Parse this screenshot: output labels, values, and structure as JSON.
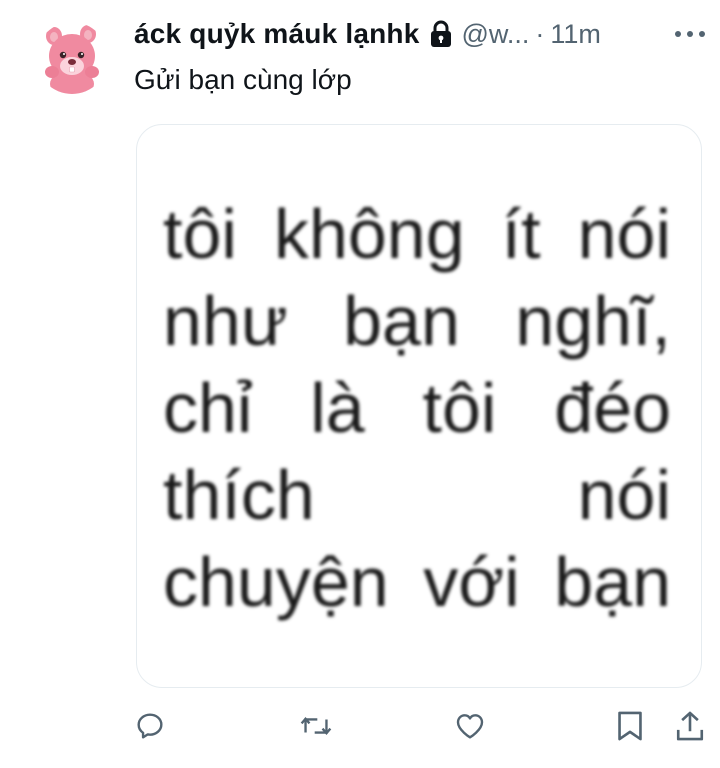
{
  "tweet": {
    "display_name": "áck quỷk máuk lạnhk",
    "handle": "@w...",
    "separator": "·",
    "time": "11m",
    "text": "Gửi bạn cùng lớp",
    "media_text_lines": [
      [
        "tôi",
        "không",
        "ít",
        "nói"
      ],
      [
        "như",
        "bạn",
        "nghĩ,"
      ],
      [
        "chỉ",
        "là",
        "tôi",
        "đéo"
      ],
      [
        "thích",
        "nói"
      ],
      [
        "chuyện",
        "với",
        "bạn"
      ]
    ]
  },
  "icons": {
    "lock": "lock-icon",
    "more": "more-icon",
    "reply": "reply-icon",
    "retweet": "retweet-icon",
    "like": "heart-icon",
    "bookmark": "bookmark-icon",
    "share": "share-icon",
    "avatar": "pink-beaver-avatar"
  },
  "colors": {
    "text_primary": "#0f1419",
    "text_secondary": "#536471",
    "icon": "#536471",
    "avatar_pink": "#f08aa0"
  }
}
